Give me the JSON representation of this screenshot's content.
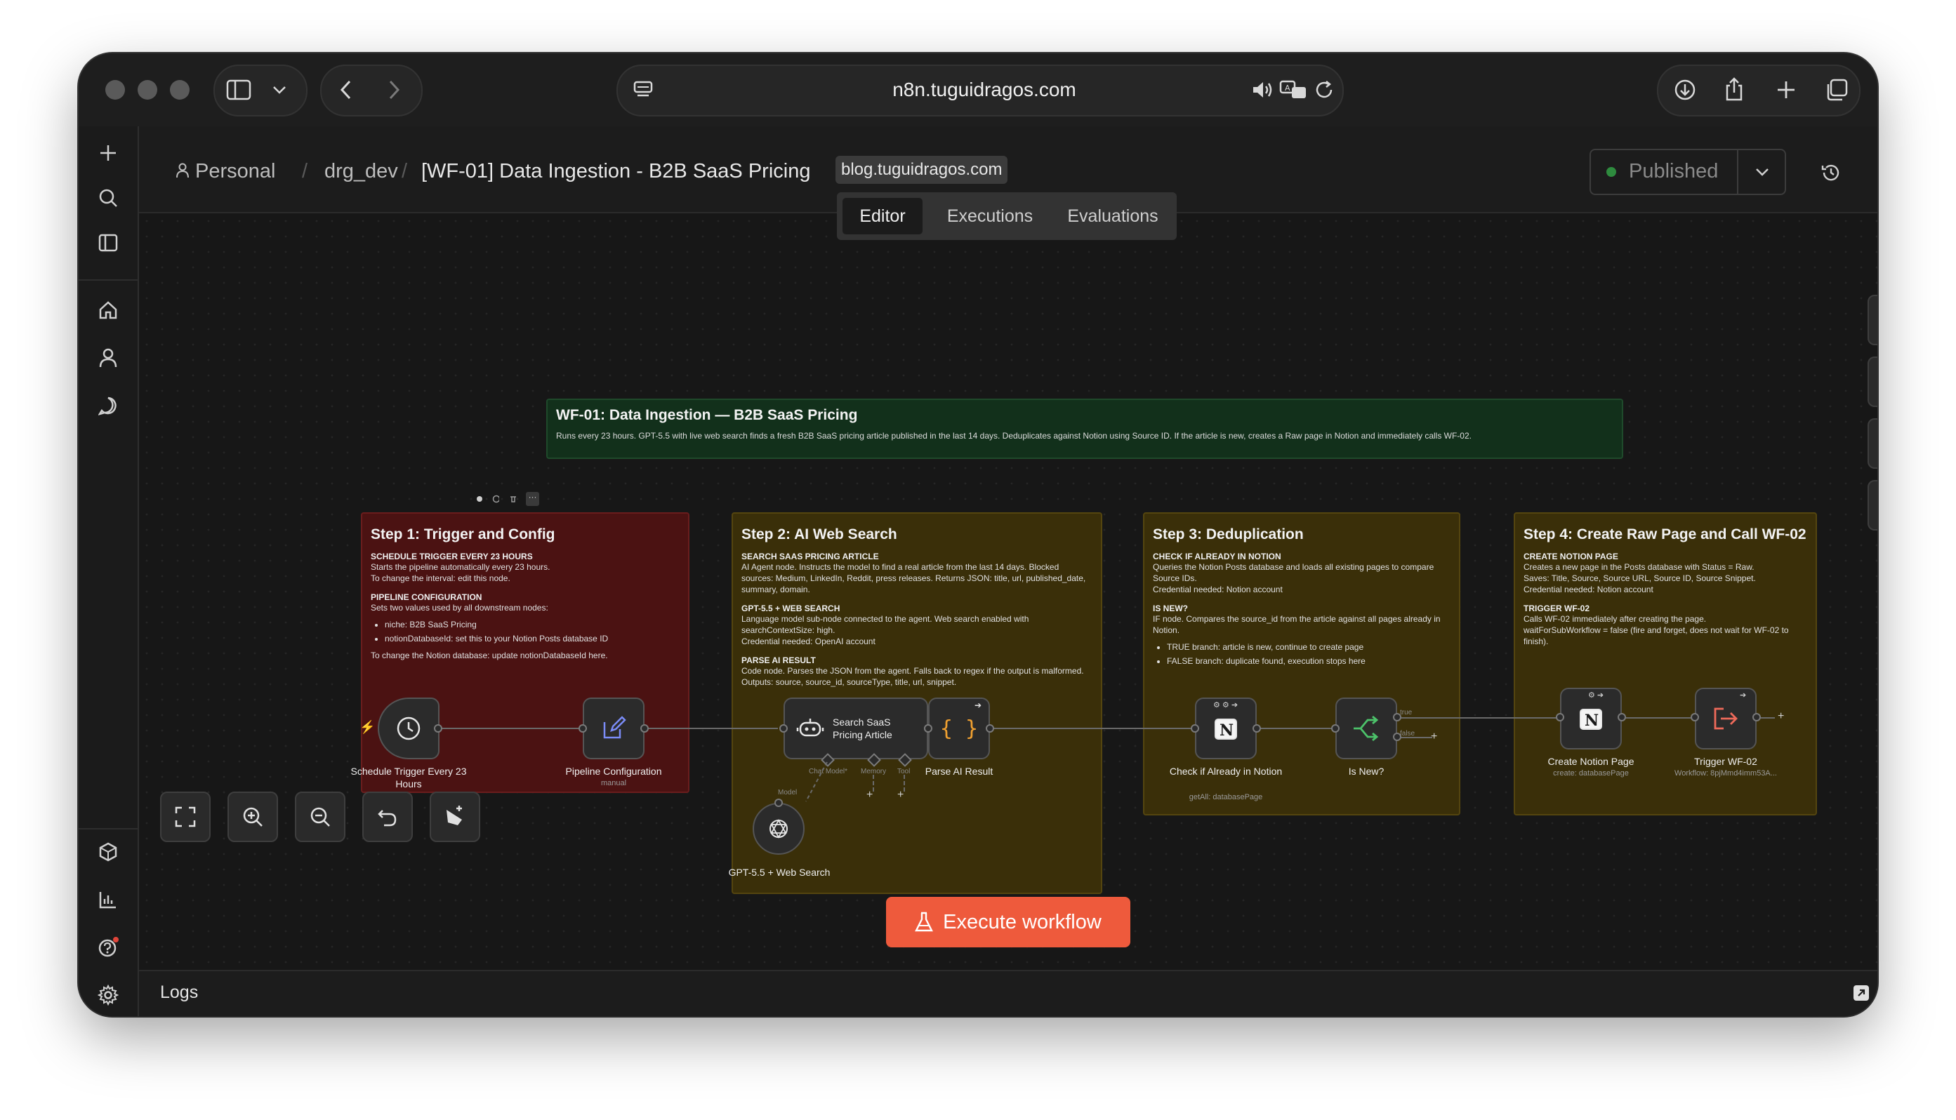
{
  "browser": {
    "url": "n8n.tuguidragos.com"
  },
  "header": {
    "breadcrumb_personal": "Personal",
    "breadcrumb_project": "drg_dev",
    "breadcrumb_workflow": "[WF-01] Data Ingestion - B2B SaaS Pricing",
    "domain_tag": "blog.tuguidragos.com",
    "published_label": "Published",
    "tabs": [
      {
        "label": "Editor",
        "active": true
      },
      {
        "label": "Executions",
        "active": false
      },
      {
        "label": "Evaluations",
        "active": false
      }
    ]
  },
  "title_note": {
    "title": "WF-01: Data Ingestion — B2B SaaS Pricing",
    "text": "Runs every 23 hours. GPT-5.5 with live web search finds a fresh B2B SaaS pricing article published in the last 14 days. Deduplicates against Notion using Source ID. If the article is new, creates a Raw page in Notion and immediately calls WF-02."
  },
  "steps": {
    "step1": {
      "title": "Step 1: Trigger and Config",
      "sec1": "SCHEDULE TRIGGER EVERY 23 HOURS",
      "sec1_text": "Starts the pipeline automatically every 23 hours.\nTo change the interval: edit this node.",
      "sec2": "PIPELINE CONFIGURATION",
      "sec2_text": "Sets two values used by all downstream nodes:",
      "bullet1": "niche: B2B SaaS Pricing",
      "bullet2": "notionDatabaseId: set this to your Notion Posts database ID",
      "footer": "To change the Notion database: update notionDatabaseId here."
    },
    "step2": {
      "title": "Step 2: AI Web Search",
      "sec1": "SEARCH SAAS PRICING ARTICLE",
      "sec1_text": "AI Agent node. Instructs the model to find a real article from the last 14 days. Blocked sources: Medium, LinkedIn, Reddit, press releases. Returns JSON: title, url, published_date, summary, domain.",
      "sec2": "GPT-5.5 + WEB SEARCH",
      "sec2_text": "Language model sub-node connected to the agent. Web search enabled with searchContextSize: high.\nCredential needed: OpenAI account",
      "sec3": "PARSE AI RESULT",
      "sec3_text": "Code node. Parses the JSON from the agent. Falls back to regex if the output is malformed. Outputs: source, source_id, sourceType, title, url, snippet."
    },
    "step3": {
      "title": "Step 3: Deduplication",
      "sec1": "CHECK IF ALREADY IN NOTION",
      "sec1_text": "Queries the Notion Posts database and loads all existing pages to compare Source IDs.\nCredential needed: Notion account",
      "sec2": "IS NEW?",
      "sec2_text": "IF node. Compares the source_id from the article against all pages already in Notion.",
      "bullet1": "TRUE branch: article is new, continue to create page",
      "bullet2": "FALSE branch: duplicate found, execution stops here"
    },
    "step4": {
      "title": "Step 4: Create Raw Page and Call WF-02",
      "sec1": "CREATE NOTION PAGE",
      "sec1_text": "Creates a new page in the Posts database with Status = Raw.\nSaves: Title, Source, Source URL, Source ID, Source Snippet.\nCredential needed: Notion account",
      "sec2": "TRIGGER WF-02",
      "sec2_text": "Calls WF-02 immediately after creating the page.\nwaitForSubWorkflow = false (fire and forget, does not wait for WF-02 to finish)."
    }
  },
  "nodes": {
    "schedule": {
      "label": "Schedule Trigger Every 23 Hours"
    },
    "pipeline": {
      "label": "Pipeline Configuration",
      "sub": "manual"
    },
    "search": {
      "label": "Search SaaS Pricing Article",
      "port_chat": "Chat Model*",
      "port_memory": "Memory",
      "port_tool": "Tool",
      "port_model": "Model"
    },
    "gpt": {
      "label": "GPT-5.5 + Web Search"
    },
    "parse": {
      "label": "Parse AI Result"
    },
    "check": {
      "label": "Check if Already in Notion",
      "sub": "getAll: databasePage"
    },
    "isnew": {
      "label": "Is New?",
      "true": "true",
      "false": "false"
    },
    "create": {
      "label": "Create Notion Page",
      "sub": "create: databasePage"
    },
    "trigger": {
      "label": "Trigger WF-02",
      "sub": "Workflow: 8pjMmd4imm53A..."
    }
  },
  "footer": {
    "execute_label": "Execute workflow",
    "logs_label": "Logs"
  },
  "colors": {
    "accent": "#ee5a3c",
    "published_dot": "#2e8b3e",
    "step1_bg": "#4b1212",
    "step_bg": "#3a2f09",
    "title_note_bg": "#12301b"
  }
}
